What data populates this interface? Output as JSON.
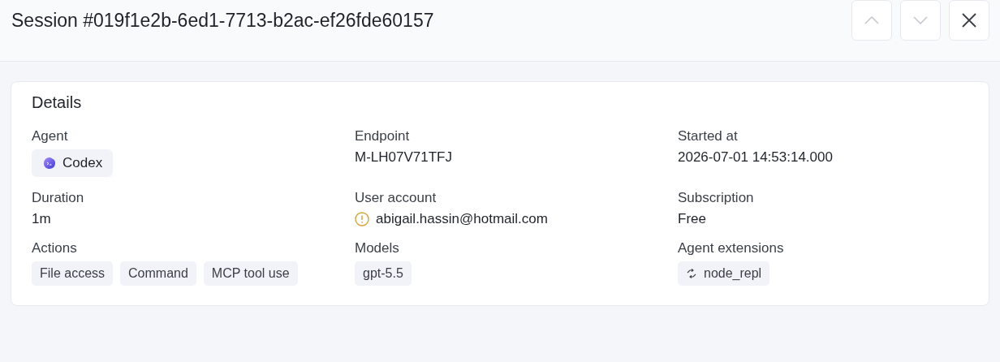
{
  "header": {
    "title": "Session #019f1e2b-6ed1-7713-b2ac-ef26fde60157",
    "buttons": [
      {
        "kind": "up",
        "disabled": true
      },
      {
        "kind": "down",
        "disabled": true
      },
      {
        "kind": "close",
        "disabled": false
      }
    ]
  },
  "details": {
    "title": "Details",
    "fields": [
      {
        "label": "Agent",
        "kind": "agent",
        "value": "Codex"
      },
      {
        "label": "Endpoint",
        "kind": "text",
        "value": "M-LH07V71TFJ"
      },
      {
        "label": "Started at",
        "kind": "text",
        "value": "2026-07-01 14:53:14.000"
      },
      {
        "label": "Duration",
        "kind": "text",
        "value": "1m"
      },
      {
        "label": "User account",
        "kind": "warning",
        "value": "abigail.hassin@hotmail.com"
      },
      {
        "label": "Subscription",
        "kind": "text",
        "value": "Free"
      },
      {
        "label": "Actions",
        "kind": "tags",
        "tags": [
          "File access",
          "Command",
          "MCP tool use"
        ]
      },
      {
        "label": "Models",
        "kind": "tags",
        "tags": [
          "gpt-5.5"
        ]
      },
      {
        "label": "Agent extensions",
        "kind": "extensions",
        "tags": [
          "node_repl"
        ]
      }
    ]
  }
}
